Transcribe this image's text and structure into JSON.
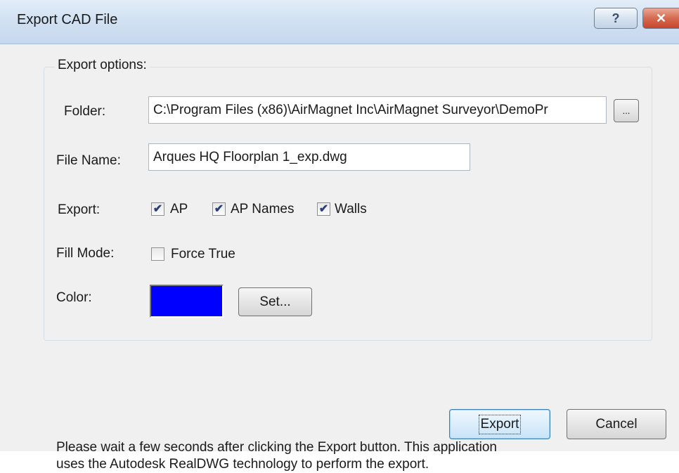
{
  "window": {
    "title": "Export CAD File",
    "help_glyph": "?",
    "close_glyph": "✕"
  },
  "group": {
    "legend": "Export options:"
  },
  "folder": {
    "label": "Folder:",
    "value": "C:\\Program Files (x86)\\AirMagnet Inc\\AirMagnet Surveyor\\DemoPr",
    "browse_label": "..."
  },
  "file_name": {
    "label": "File Name:",
    "value": "Arques HQ Floorplan 1_exp.dwg"
  },
  "export": {
    "label": "Export:",
    "options": [
      {
        "label": "AP",
        "checked": true
      },
      {
        "label": "AP Names",
        "checked": true
      },
      {
        "label": "Walls",
        "checked": true
      }
    ]
  },
  "fill_mode": {
    "label": "Fill Mode:",
    "option": {
      "label": "Force True",
      "checked": false
    }
  },
  "color": {
    "label": "Color:",
    "value": "#0000ff",
    "set_label": "Set..."
  },
  "note": {
    "line1": "Please wait a few seconds after clicking the Export button. This application",
    "line2": "uses the Autodesk RealDWG technology to perform the export."
  },
  "buttons": {
    "export_label": "Export",
    "cancel_label": "Cancel"
  },
  "icons": {
    "help": "help-icon",
    "close": "close-icon",
    "check": "checkmark-icon"
  }
}
